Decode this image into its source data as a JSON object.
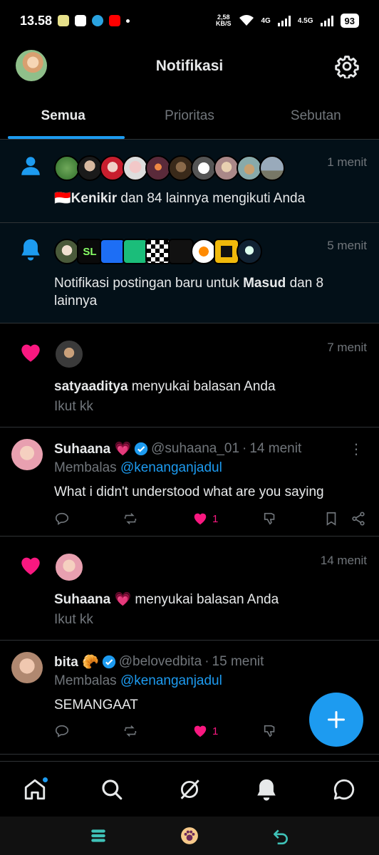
{
  "status_bar": {
    "time": "13.58",
    "net_speed_value": "2,58",
    "net_speed_unit": "KB/S",
    "network_1": "4G",
    "network_2": "4.5G",
    "battery": "93"
  },
  "header": {
    "title": "Notifikasi"
  },
  "tabs": [
    {
      "label": "Semua",
      "active": true
    },
    {
      "label": "Prioritas",
      "active": false
    },
    {
      "label": "Sebutan",
      "active": false
    }
  ],
  "notifications": [
    {
      "type": "follow",
      "time": "1 menit",
      "flag": "🇮🇩",
      "actor": "Kenikir",
      "text": " dan 84 lainnya mengikuti Anda"
    },
    {
      "type": "post-notification",
      "time": "5 menit",
      "text_before": "Notifikasi postingan baru untuk ",
      "actor": "Masud",
      "text_after": " dan 8 lainnya",
      "brand_badge": "SL"
    },
    {
      "type": "like",
      "time": "7 menit",
      "actor": "satyaaditya",
      "text": " menyukai balasan Anda",
      "sub": "Ikut kk"
    },
    {
      "type": "reply",
      "name": "Suhaana 💗",
      "handle": "@suhaana_01",
      "time": "14 menit",
      "replying_label": "Membalas",
      "replying_to": "@kenanganjadul",
      "text": "What i didn't understood what are you saying",
      "likes": "1"
    },
    {
      "type": "like",
      "time": "14 menit",
      "actor": "Suhaana 💗",
      "text": " menyukai balasan Anda",
      "sub": "Ikut kk"
    },
    {
      "type": "reply",
      "name": "bita 🥐",
      "handle": "@belovedbita",
      "time": "15 menit",
      "replying_label": "Membalas",
      "replying_to": "@kenanganjadul",
      "text": "SEMANGAAT",
      "likes": "1"
    }
  ],
  "colors": {
    "accent": "#1d9bf0",
    "like": "#f91880",
    "muted": "#71767b",
    "highlight_bg": "#031018"
  },
  "bottom_nav": [
    "home-icon",
    "search-icon",
    "grok-icon",
    "notifications-icon",
    "messages-icon"
  ],
  "system_nav": [
    "menu-icon",
    "home-paw-icon",
    "back-icon"
  ]
}
